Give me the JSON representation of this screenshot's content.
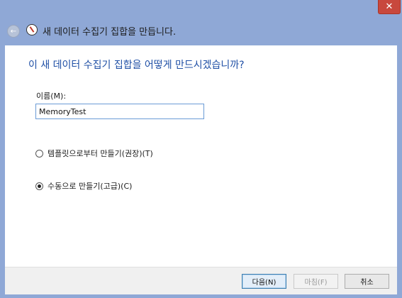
{
  "window": {
    "title": "새 데이터 수집기 집합을 만듭니다.",
    "close_glyph": "✕",
    "back_glyph": "←"
  },
  "main": {
    "heading": "이 새 데이터 수집기 집합을 어떻게 만드시겠습니까?",
    "name_label": "이름(M):",
    "name_value": "MemoryTest",
    "options": [
      {
        "label": "템플릿으로부터 만들기(권장)(T)",
        "checked": false
      },
      {
        "label": "수동으로 만들기(고급)(C)",
        "checked": true
      }
    ]
  },
  "footer": {
    "next_label": "다음(N)",
    "finish_label": "마침(F)",
    "cancel_label": "취소"
  }
}
